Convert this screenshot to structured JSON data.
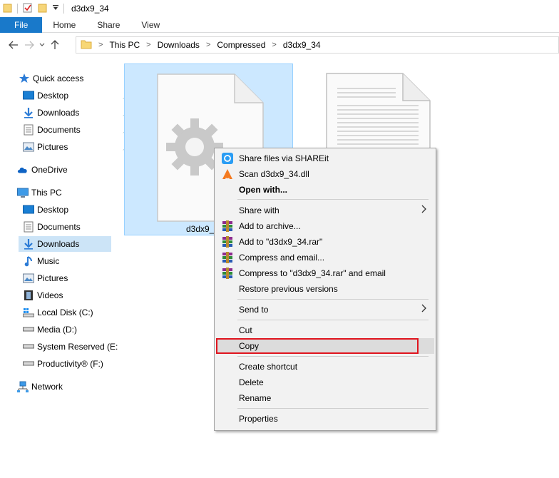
{
  "window": {
    "title": "d3dx9_34"
  },
  "ribbon": {
    "tabs": [
      "File",
      "Home",
      "Share",
      "View"
    ]
  },
  "address": {
    "crumbs": [
      "This PC",
      "Downloads",
      "Compressed",
      "d3dx9_34"
    ]
  },
  "nav": {
    "quick_access": "Quick access",
    "qa_items": [
      "Desktop",
      "Downloads",
      "Documents",
      "Pictures"
    ],
    "onedrive": "OneDrive",
    "this_pc": "This PC",
    "pc_items": [
      "Desktop",
      "Documents",
      "Downloads",
      "Music",
      "Pictures",
      "Videos",
      "Local Disk (C:)",
      "Media (D:)",
      "System Reserved (E:",
      "Productivity® (F:)"
    ],
    "network": "Network",
    "selected": "Downloads"
  },
  "files": [
    {
      "name": "d3dx9_3",
      "type": "dll",
      "selected": true
    },
    {
      "name": "",
      "type": "text",
      "selected": false
    }
  ],
  "context_menu": {
    "items": [
      {
        "label": "Share files via SHAREit",
        "icon": "shareit-icon"
      },
      {
        "label": "Scan d3dx9_34.dll",
        "icon": "avast-icon"
      },
      {
        "label": "Open with...",
        "bold": true
      },
      {
        "label": "Share with",
        "submenu": true
      },
      {
        "label": "Add to archive...",
        "icon": "winrar-icon"
      },
      {
        "label": "Add to \"d3dx9_34.rar\"",
        "icon": "winrar-icon"
      },
      {
        "label": "Compress and email...",
        "icon": "winrar-icon"
      },
      {
        "label": "Compress to \"d3dx9_34.rar\" and email",
        "icon": "winrar-icon"
      },
      {
        "label": "Restore previous versions"
      },
      {
        "label": "Send to",
        "submenu": true
      },
      {
        "label": "Cut"
      },
      {
        "label": "Copy",
        "highlighted": true
      },
      {
        "label": "Create shortcut"
      },
      {
        "label": "Delete"
      },
      {
        "label": "Rename"
      },
      {
        "label": "Properties"
      }
    ]
  },
  "colors": {
    "accent": "#1979ca",
    "selection": "#cce8ff",
    "highlight_border": "#e0141e"
  }
}
